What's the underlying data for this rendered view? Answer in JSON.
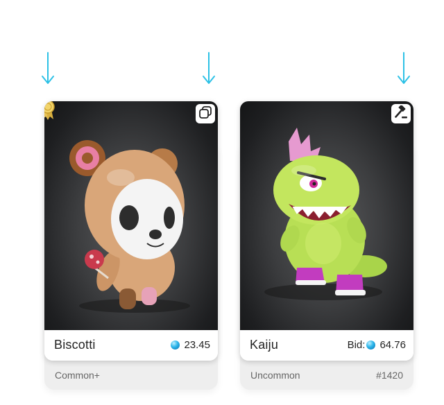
{
  "cards": [
    {
      "name": "Biscotti",
      "price": "23.45",
      "bid_prefix": "",
      "rarity": "Common+",
      "serial": "",
      "corner_icon": "copy-icon",
      "badge_icon": "medal-icon"
    },
    {
      "name": "Kaiju",
      "price": "64.76",
      "bid_prefix": "Bid:",
      "rarity": "Uncommon",
      "serial": "#1420",
      "corner_icon": "gavel-icon",
      "badge_icon": ""
    }
  ],
  "colors": {
    "arrow": "#2cc1e6",
    "gem": "#2bb5ea",
    "card_under": "#eeeeee",
    "image_bg": "#2a2b2d"
  },
  "icons": [
    "down-arrow-icon",
    "medal-icon",
    "copy-icon",
    "gavel-icon",
    "gem-icon"
  ]
}
